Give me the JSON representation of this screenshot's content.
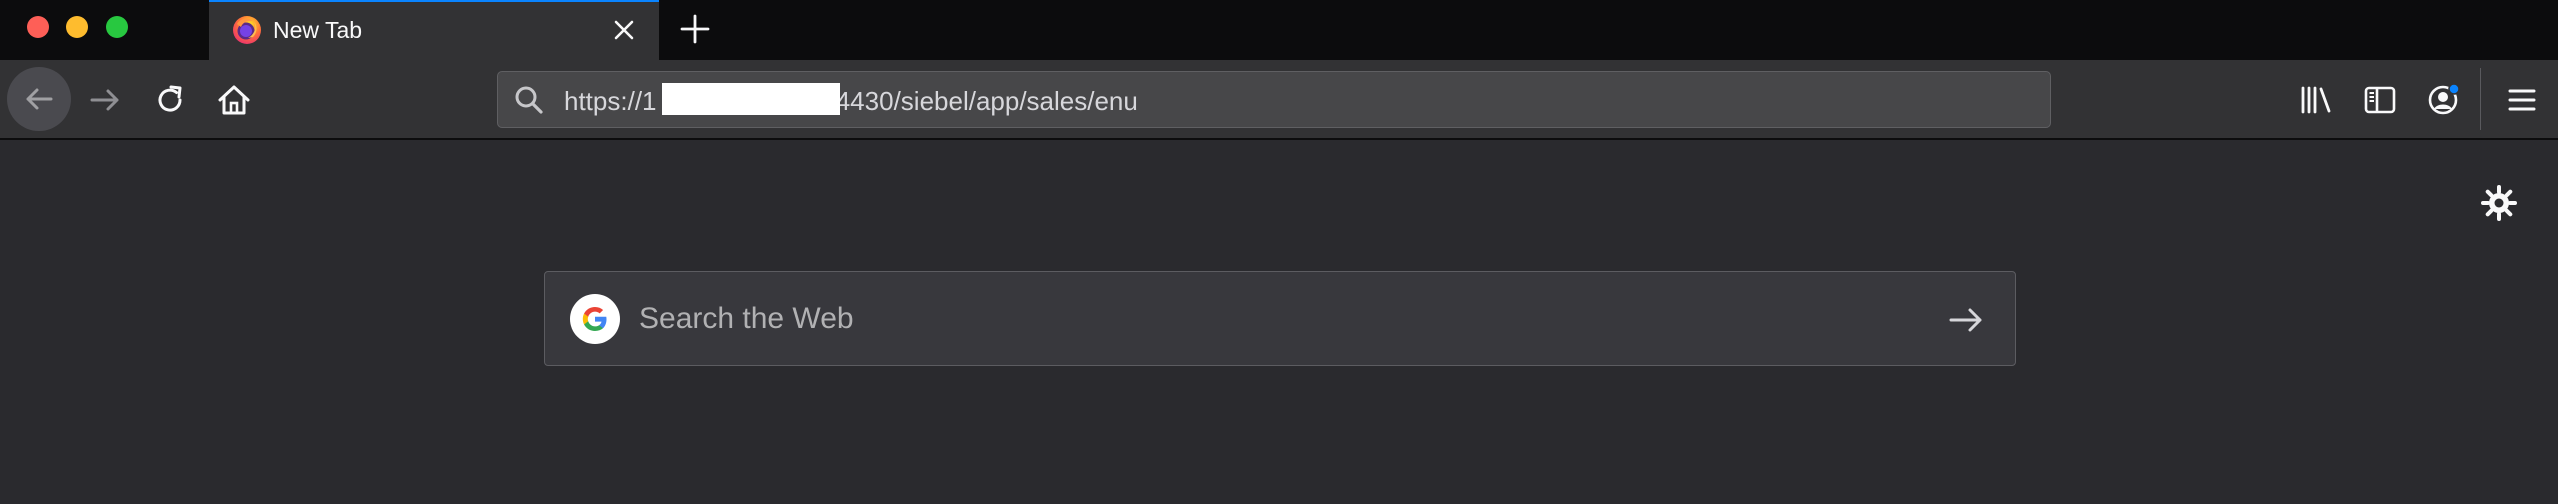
{
  "browser": {
    "tab": {
      "title": "New Tab",
      "favicon": "firefox-icon"
    },
    "controls": {
      "window_buttons": [
        "close",
        "minimize",
        "zoom"
      ],
      "newtab_icon": "plus-icon",
      "tab_close_icon": "close-icon"
    },
    "navbar": {
      "back_icon": "arrow-left-icon",
      "forward_icon": "arrow-right-icon",
      "reload_icon": "reload-icon",
      "home_icon": "home-icon",
      "url_prefix": "https://1",
      "url_suffix": ":4430/siebel/app/sales/enu",
      "url_redacted": true,
      "right_icons": [
        "library-icon",
        "sidebar-icon",
        "account-icon",
        "menu-icon"
      ]
    }
  },
  "newtab": {
    "search": {
      "engine_icon": "google-icon",
      "placeholder": "Search the Web",
      "go_icon": "arrow-right-icon"
    },
    "settings_icon": "gear-icon"
  },
  "colors": {
    "tabstrip_bg": "#0c0c0d",
    "toolbar_bg": "#323234",
    "content_bg": "#2a2a2e",
    "accent": "#0a84ff"
  }
}
